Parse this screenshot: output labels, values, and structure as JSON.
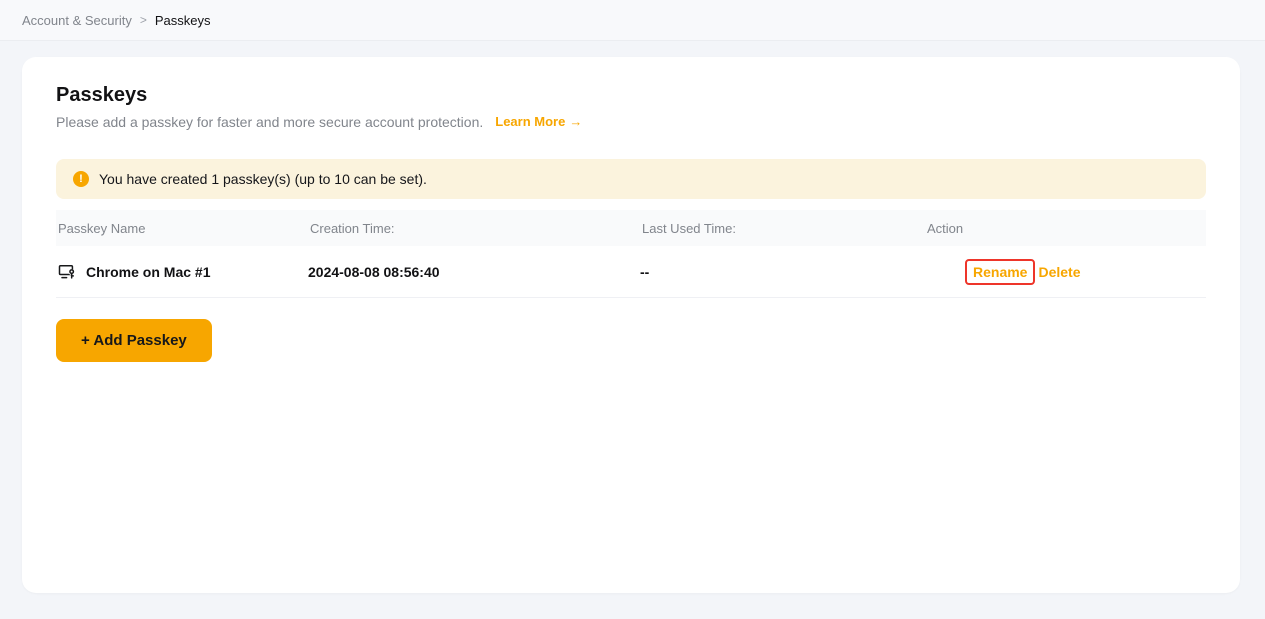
{
  "breadcrumb": {
    "parent": "Account & Security",
    "separator": ">",
    "current": "Passkeys"
  },
  "page": {
    "title": "Passkeys",
    "description": "Please add a passkey for faster and more secure account protection.",
    "learn_more_label": "Learn More",
    "learn_more_arrow": "→"
  },
  "notice": {
    "icon": "info-exclamation-icon",
    "icon_glyph": "!",
    "text": "You have created 1 passkey(s) (up to 10 can be set)."
  },
  "table": {
    "headers": [
      "Passkey Name",
      "Creation Time:",
      "Last Used Time:",
      "Action"
    ],
    "rows": [
      {
        "icon": "passkey-device-icon",
        "name": "Chrome on Mac #1",
        "creation_time": "2024-08-08 08:56:40",
        "last_used_time": "--",
        "actions": {
          "rename": "Rename",
          "delete": "Delete"
        },
        "rename_highlighted": true
      }
    ]
  },
  "add_button": {
    "label": "+ Add Passkey"
  },
  "colors": {
    "accent": "#F7A600",
    "notice_background": "#FBF3DD",
    "annotation_highlight": "#EE352A",
    "page_background": "#F3F5F9",
    "card_background": "#FFFFFF",
    "muted_text": "#81858C",
    "primary_text": "#121214"
  }
}
